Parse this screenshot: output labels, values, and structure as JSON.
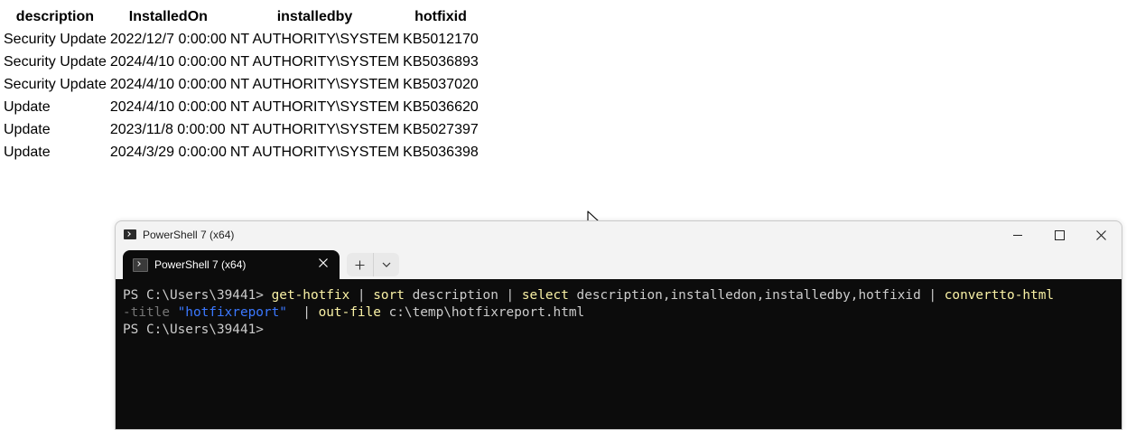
{
  "report": {
    "headers": [
      "description",
      "InstalledOn",
      "installedby",
      "hotfixid"
    ],
    "rows": [
      [
        "Security Update",
        "2022/12/7 0:00:00",
        "NT AUTHORITY\\SYSTEM",
        "KB5012170"
      ],
      [
        "Security Update",
        "2024/4/10 0:00:00",
        "NT AUTHORITY\\SYSTEM",
        "KB5036893"
      ],
      [
        "Security Update",
        "2024/4/10 0:00:00",
        "NT AUTHORITY\\SYSTEM",
        "KB5037020"
      ],
      [
        "Update",
        "2024/4/10 0:00:00",
        "NT AUTHORITY\\SYSTEM",
        "KB5036620"
      ],
      [
        "Update",
        "2023/11/8 0:00:00",
        "NT AUTHORITY\\SYSTEM",
        "KB5027397"
      ],
      [
        "Update",
        "2024/3/29 0:00:00",
        "NT AUTHORITY\\SYSTEM",
        "KB5036398"
      ]
    ]
  },
  "window": {
    "title": "PowerShell 7 (x64)",
    "tab_label": "PowerShell 7 (x64)",
    "icons": {
      "app": "powershell-icon",
      "minimize": "minimize-icon",
      "maximize": "maximize-icon",
      "close": "close-icon",
      "tab_close": "close-icon",
      "new_tab": "plus-icon",
      "dropdown": "chevron-down-icon"
    }
  },
  "console": {
    "prompt": "PS C:\\Users\\39441> ",
    "cmd1": "get-hotfix",
    "pipe1": " | ",
    "cmd2": "sort",
    "arg2": " description | ",
    "cmd3": "select",
    "arg3": " description,installedon,installedby,hotfixid | ",
    "cmd4": "convertto-html",
    "param": "-title",
    "str": " \"hotfixreport\"",
    "pipe2": "  | ",
    "cmd5": "out-file",
    "arg5": " c:\\temp\\hotfixreport.html",
    "prompt2": "PS C:\\Users\\39441>"
  },
  "colors": {
    "console_bg": "#0c0c0c",
    "cmdlet": "#f9f1a5",
    "parameter": "#767676",
    "string": "#3b78ff",
    "text": "#cccccc"
  }
}
